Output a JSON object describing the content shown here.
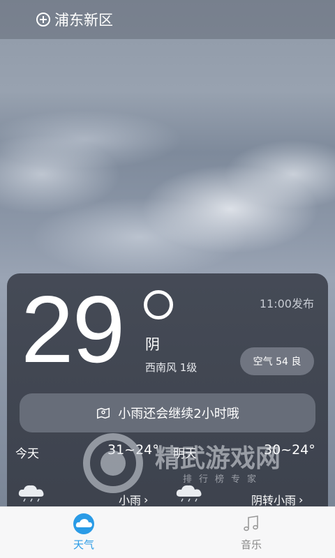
{
  "location": {
    "name": "浦东新区",
    "add_icon": "plus-circle-icon"
  },
  "current": {
    "temperature": "29",
    "condition": "阴",
    "wind": "西南风 1级",
    "publish_time": "11:00发布",
    "air_quality": "空气 54 良"
  },
  "notice": {
    "text": "小雨还会继续2小时哦",
    "icon": "map-pin-icon"
  },
  "forecast": [
    {
      "day": "今天",
      "temp_range": "31~24°",
      "condition": "小雨",
      "icon": "cloud-rain-icon"
    },
    {
      "day": "明天",
      "temp_range": "30~24°",
      "condition": "阴转小雨",
      "icon": "cloud-rain-icon"
    }
  ],
  "watermark": {
    "title": "精武游戏网",
    "subtitle": "排行榜专家"
  },
  "nav": [
    {
      "label": "天气",
      "icon": "cloud-icon",
      "active": true
    },
    {
      "label": "音乐",
      "icon": "music-note-icon",
      "active": false
    }
  ],
  "colors": {
    "accent": "#2a9be6",
    "card_bg": "#3e434e"
  }
}
